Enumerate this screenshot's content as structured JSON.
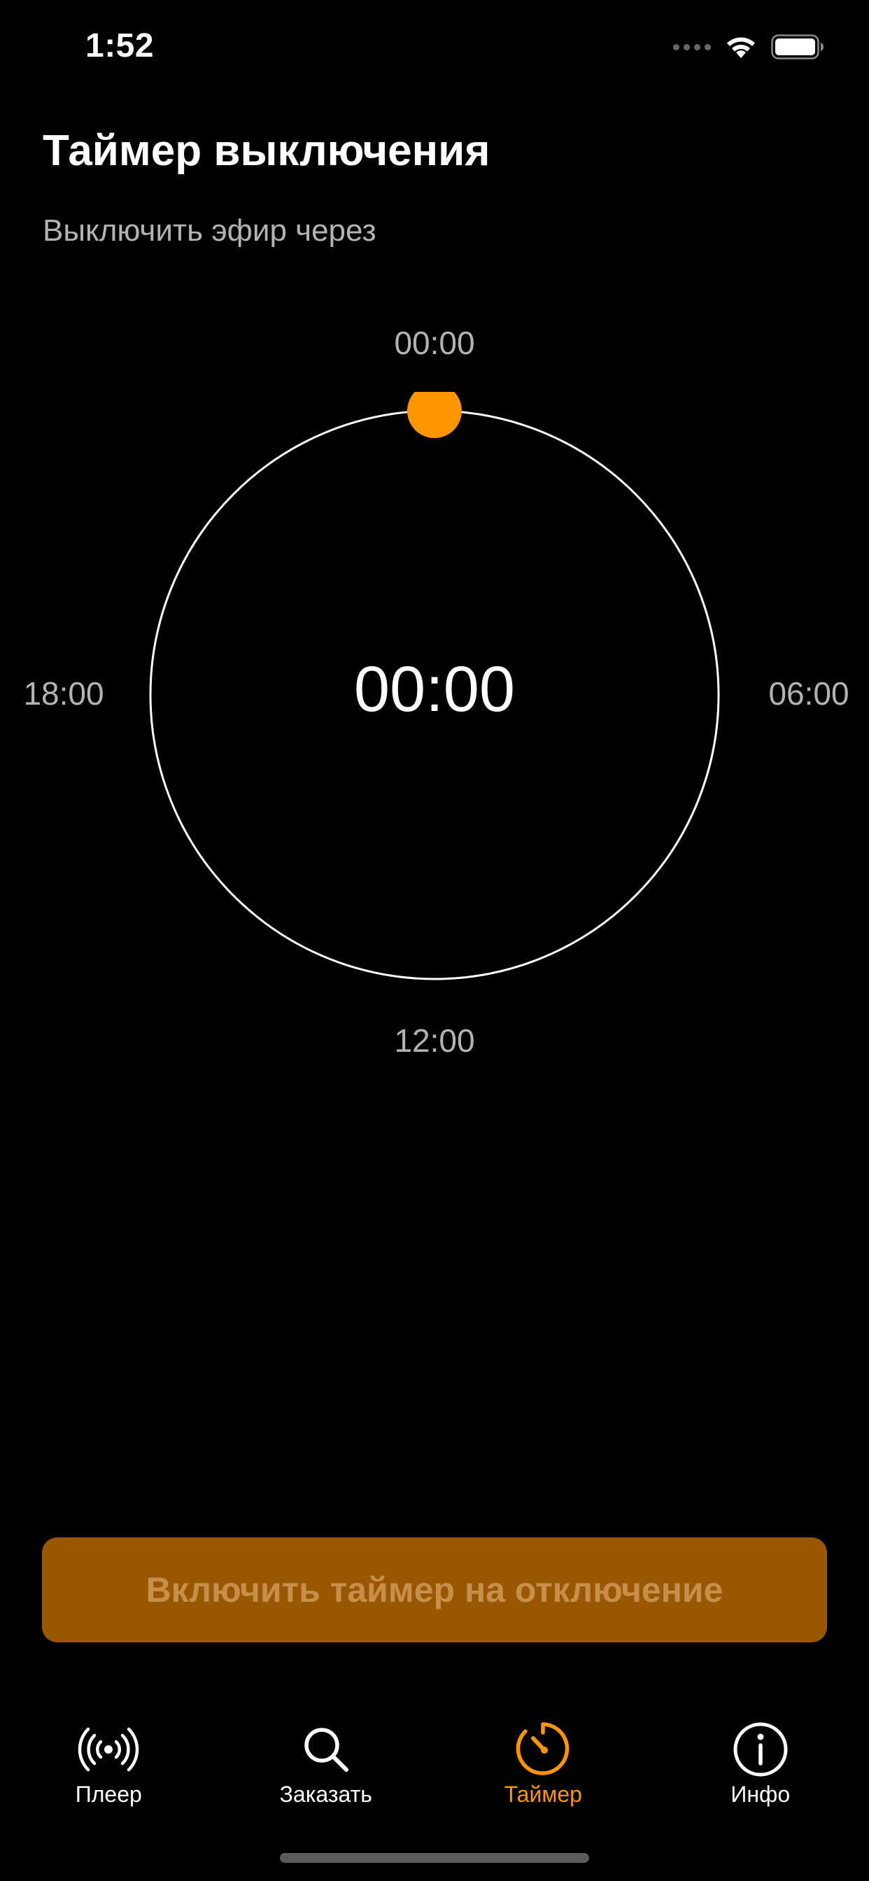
{
  "status_bar": {
    "time": "1:52",
    "icons": [
      "signal-dots-icon",
      "wifi-icon",
      "battery-icon"
    ]
  },
  "header": {
    "title": "Таймер выключения",
    "subtitle": "Выключить эфир через"
  },
  "dial": {
    "label_top": "00:00",
    "label_right": "06:00",
    "label_bottom": "12:00",
    "label_left": "18:00",
    "center_value": "00:00",
    "handle_position_fraction": 0,
    "ring_color": "#ffffff",
    "handle_color": "#ff9500"
  },
  "action": {
    "button_label": "Включить таймер на отключение",
    "button_color": "#9a5702"
  },
  "tabs": [
    {
      "label": "Плеер",
      "icon": "broadcast-icon",
      "active": false
    },
    {
      "label": "Заказать",
      "icon": "search-icon",
      "active": false
    },
    {
      "label": "Таймер",
      "icon": "timer-icon",
      "active": true
    },
    {
      "label": "Инфо",
      "icon": "info-icon",
      "active": false
    }
  ],
  "colors": {
    "accent": "#ff9500",
    "background": "#000000",
    "secondary_text": "#b3b3b3"
  }
}
